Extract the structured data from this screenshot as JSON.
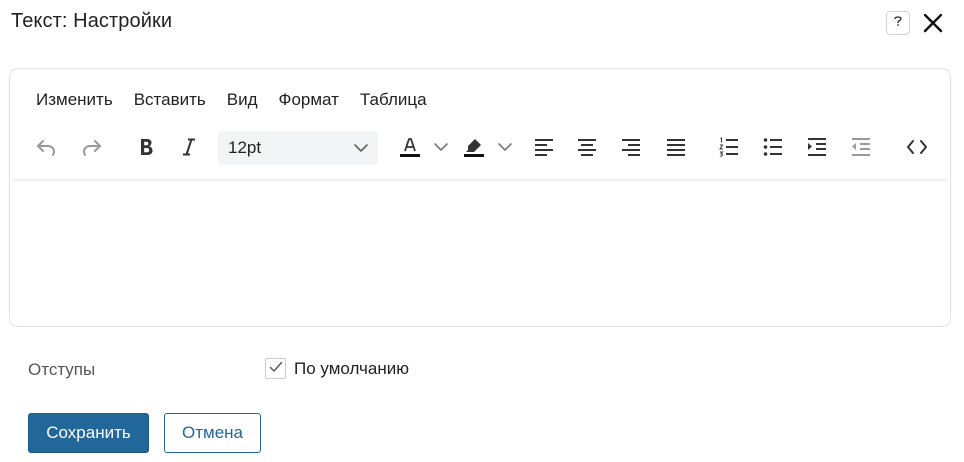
{
  "dialog": {
    "title": "Текст: Настройки"
  },
  "header": {
    "help_icon": "help-question-icon",
    "close_icon": "close-icon"
  },
  "editor": {
    "menu": [
      "Изменить",
      "Вставить",
      "Вид",
      "Формат",
      "Таблица"
    ],
    "toolbar": {
      "font_size": "12pt",
      "icons": [
        "undo-icon",
        "redo-icon",
        "bold-icon",
        "italic-icon",
        "text-color-icon",
        "highlight-color-icon",
        "align-left-icon",
        "align-center-icon",
        "align-right-icon",
        "align-justify-icon",
        "numbered-list-icon",
        "bullet-list-icon",
        "indent-icon",
        "outdent-icon",
        "source-code-icon"
      ]
    },
    "content": ""
  },
  "indents": {
    "label": "Отступы",
    "default_checkbox_label": "По умолчанию",
    "default_checked": true
  },
  "buttons": {
    "save": "Сохранить",
    "cancel": "Отмена"
  },
  "colors": {
    "primary": "#22679a",
    "border": "#e1e3e6",
    "select_bg": "#f3f4f6",
    "icon": "#333333",
    "icon_disabled": "#999999"
  }
}
